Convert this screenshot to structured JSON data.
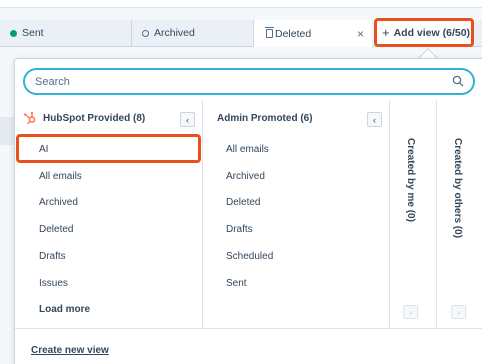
{
  "tabs": [
    {
      "label": "Sent",
      "icon": "dot-filled-icon",
      "color": "#00a36a"
    },
    {
      "label": "Archived",
      "icon": "dot-outline-icon"
    },
    {
      "label": "Deleted",
      "icon": "trash-icon"
    }
  ],
  "tab_close_glyph": "×",
  "add_view": {
    "plus": "+",
    "label": "Add view (6/50)"
  },
  "search": {
    "placeholder": "Search",
    "icon": "search-icon"
  },
  "columns": {
    "hubspot": {
      "title": "HubSpot Provided (8)",
      "collapse_glyph": "‹",
      "items": [
        "AI",
        "All emails",
        "Archived",
        "Deleted",
        "Drafts",
        "Issues"
      ],
      "load_more": "Load more"
    },
    "admin": {
      "title": "Admin Promoted (6)",
      "collapse_glyph": "‹",
      "items": [
        "All emails",
        "Archived",
        "Deleted",
        "Drafts",
        "Scheduled",
        "Sent"
      ]
    },
    "me": {
      "title": "Created by me (0)",
      "expand_glyph": "›"
    },
    "others": {
      "title": "Created by others (0)",
      "expand_glyph": "›"
    }
  },
  "create_new_view": "Create new view",
  "colors": {
    "highlight": "#e8511b",
    "focus": "#2eb3d6",
    "brand": "#ff7a59"
  }
}
